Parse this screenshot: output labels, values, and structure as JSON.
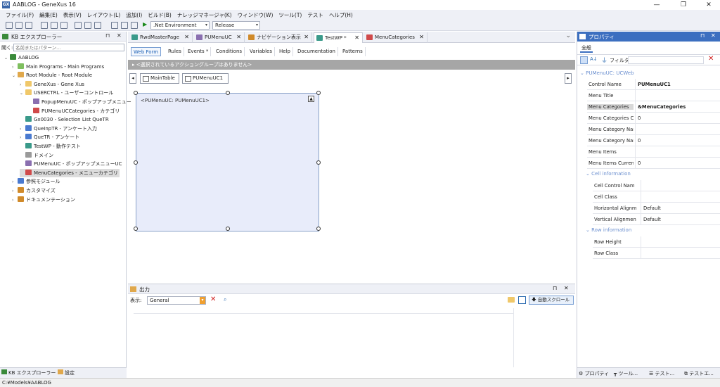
{
  "window": {
    "title": "AABLOG - GeneXus 16",
    "app_icon": "GX",
    "minimize": "—",
    "maximize": "❐",
    "close": "✕"
  },
  "menu": [
    "ファイル(F)",
    "編集(E)",
    "表示(V)",
    "レイアウト(L)",
    "追加(I)",
    "ビルド(B)",
    "ナレッジマネージャ(K)",
    "ウィンドウ(W)",
    "ツール(T)",
    "テスト",
    "ヘルプ(H)"
  ],
  "toolbar": {
    "environment": ".Net Environment",
    "configuration": "Release"
  },
  "kb_explorer": {
    "title": "KB エクスプローラー",
    "filter_label": "開く:",
    "filter_placeholder": "名前またはパターン...",
    "tree": [
      {
        "label": "AABLOG",
        "level": 0,
        "exp": "⌄",
        "icon": "kb-icon",
        "color": "#3a8a3a"
      },
      {
        "label": "Main Programs - Main Programs",
        "level": 1,
        "exp": "›",
        "icon": "folder-icon",
        "color": "#7fbf5f"
      },
      {
        "label": "Root Module - Root Module",
        "level": 1,
        "exp": "⌄",
        "icon": "module-icon",
        "color": "#e0a84c"
      },
      {
        "label": "GeneXus - Gene Xus",
        "level": 2,
        "exp": "›",
        "icon": "folder-icon",
        "color": "#f0c86a"
      },
      {
        "label": "USERCTRL - ユーザーコントロール",
        "level": 2,
        "exp": "⌄",
        "icon": "folder-icon",
        "color": "#f0c86a"
      },
      {
        "label": "PopupMenuUC - ポップアップメニュー",
        "level": 3,
        "exp": "",
        "icon": "usercontrol-icon",
        "color": "#8a6fb0"
      },
      {
        "label": "PUMenuUCCategories - カテゴリ",
        "level": 3,
        "exp": "",
        "icon": "sdt-icon",
        "color": "#d04a4a"
      },
      {
        "label": "Gx0030 - Selection List QueTR",
        "level": 2,
        "exp": "",
        "icon": "webpanel-icon",
        "color": "#3a9a8a"
      },
      {
        "label": "QueInpTR - アンケート入力",
        "level": 2,
        "exp": "›",
        "icon": "transaction-icon",
        "color": "#4a7ad0"
      },
      {
        "label": "QueTR - アンケート",
        "level": 2,
        "exp": "›",
        "icon": "transaction-icon",
        "color": "#4a7ad0"
      },
      {
        "label": "TestWP - 動作テスト",
        "level": 2,
        "exp": "",
        "icon": "webpanel-icon",
        "color": "#3a9a8a"
      },
      {
        "label": "ドメイン",
        "level": 2,
        "exp": "",
        "icon": "domain-icon",
        "color": "#9a9a9a"
      },
      {
        "label": "PUMenuUC - ポップアップメニューUC",
        "level": 2,
        "exp": "",
        "icon": "usercontrol-icon",
        "color": "#8a6fb0"
      },
      {
        "label": "MenuCategories - メニューカテゴリ",
        "level": 2,
        "exp": "",
        "icon": "sdt-icon",
        "color": "#d04a4a",
        "selected": true
      },
      {
        "label": "参照モジュール",
        "level": 1,
        "exp": "›",
        "icon": "references-icon",
        "color": "#4a7ad0"
      },
      {
        "label": "カスタマイズ",
        "level": 1,
        "exp": "›",
        "icon": "customize-icon",
        "color": "#d08a2a"
      },
      {
        "label": "ドキュメンテーション",
        "level": 1,
        "exp": "›",
        "icon": "documentation-icon",
        "color": "#d08a2a"
      }
    ],
    "bottom_tabs": [
      "KB エクスプローラー",
      "設定"
    ]
  },
  "doc_tabs": [
    {
      "label": "RwdMasterPage",
      "icon": "masterpage-icon",
      "color": "#3a9a8a"
    },
    {
      "label": "PUMenuUC",
      "icon": "usercontrol-icon",
      "color": "#8a6fb0"
    },
    {
      "label": "ナビゲーション表示",
      "icon": "navigation-icon",
      "color": "#d08a2a"
    },
    {
      "label": "TestWP *",
      "icon": "webpanel-icon",
      "color": "#3a9a8a",
      "active": true
    },
    {
      "label": "MenuCategories",
      "icon": "sdt-icon",
      "color": "#d04a4a"
    }
  ],
  "sub_tabs": [
    "Web Form",
    "Rules",
    "Events *",
    "Conditions",
    "Variables",
    "Help",
    "Documentation",
    "Patterns"
  ],
  "action_group": "▸ <選択されているアクショングループはありません>",
  "breadcrumb": [
    "MainTable",
    "PUMenuUC1"
  ],
  "design": {
    "control_text": "<PUMenuUC: PUMenuUC1>"
  },
  "output": {
    "title": "出力",
    "display_label": "表示:",
    "display_value": "General",
    "autoscroll": "自動スクロール"
  },
  "properties": {
    "title": "プロパティ",
    "tab": "全般",
    "filter_label": "フィルタ",
    "object_name": "PUMenuUC: UCWeb",
    "rows": [
      {
        "name": "Control Name",
        "value": "PUMenuUC1",
        "bold": true
      },
      {
        "name": "Menu Title",
        "value": ""
      },
      {
        "name": "Menu Categories",
        "value": "&MenuCategories",
        "bold": true,
        "highlight": true
      },
      {
        "name": "Menu Categories Cu",
        "value": "0"
      },
      {
        "name": "Menu Category Nam",
        "value": ""
      },
      {
        "name": "Menu Category Nam",
        "value": "0"
      },
      {
        "name": "Menu Items",
        "value": ""
      },
      {
        "name": "Menu Items Current",
        "value": "0"
      }
    ],
    "cell_header": "Cell information",
    "cell_rows": [
      {
        "name": "Cell Control Nam",
        "value": ""
      },
      {
        "name": "Cell Class",
        "value": ""
      },
      {
        "name": "Horizontal Alignm",
        "value": "Default"
      },
      {
        "name": "Vertical Alignmen",
        "value": "Default"
      }
    ],
    "row_header": "Row information",
    "row_rows": [
      {
        "name": "Row Height",
        "value": ""
      },
      {
        "name": "Row Class",
        "value": ""
      }
    ],
    "bottom_tabs": [
      "プロパティ",
      "ツール...",
      "テスト...",
      "テストエ..."
    ]
  },
  "status_bar": "C:¥Models¥AABLOG"
}
